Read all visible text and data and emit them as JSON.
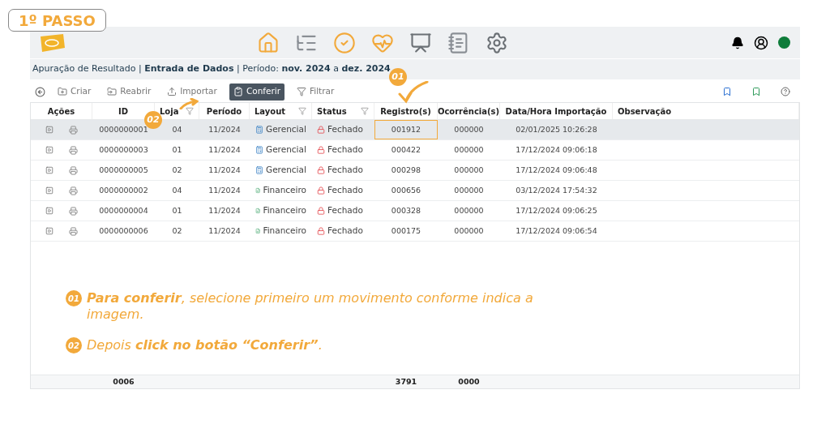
{
  "step_badge": "1º PASSO",
  "breadcrumb": "Apuração de Resultado | **Entrada de Dados** | Período: **nov. 2024** a **dez. 2024**",
  "pointer_badges": [
    {
      "number": "01"
    },
    {
      "number": "02"
    }
  ],
  "toolbar": [
    {
      "label": "Criar",
      "kind": "create",
      "selected": false
    },
    {
      "label": "Reabrir",
      "kind": "reopen",
      "selected": false
    },
    {
      "label": "Importar",
      "kind": "import",
      "selected": false
    },
    {
      "label": "Conferir",
      "kind": "check",
      "selected": true
    },
    {
      "label": "Filtrar",
      "kind": "filter",
      "selected": false
    }
  ],
  "table": {
    "columns": [
      {
        "label": "Ações",
        "filter": false
      },
      {
        "label": "ID",
        "filter": false
      },
      {
        "label": "Loja",
        "filter": true
      },
      {
        "label": "Período",
        "filter": false
      },
      {
        "label": "Layout",
        "filter": true
      },
      {
        "label": "Status",
        "filter": true
      },
      {
        "label": "Registro(s)",
        "filter": false
      },
      {
        "label": "Ocorrência(s)",
        "filter": false
      },
      {
        "label": "Data/Hora Importação",
        "filter": false
      },
      {
        "label": "Observação",
        "filter": false
      }
    ],
    "rows": [
      {
        "selected": true,
        "id": "0000000001",
        "store": "04",
        "period": "11/2024",
        "layout": "Gerencial",
        "kind": "gerencial",
        "status": "Fechado",
        "records": "001912",
        "records_highlighted": true,
        "occurrences": "000000",
        "imported_at": "02/01/2025 10:26:28"
      },
      {
        "selected": false,
        "id": "0000000003",
        "store": "01",
        "period": "11/2024",
        "layout": "Gerencial",
        "kind": "gerencial",
        "status": "Fechado",
        "records": "000422",
        "records_highlighted": false,
        "occurrences": "000000",
        "imported_at": "17/12/2024 09:06:18"
      },
      {
        "selected": false,
        "id": "0000000005",
        "store": "02",
        "period": "11/2024",
        "layout": "Gerencial",
        "kind": "gerencial",
        "status": "Fechado",
        "records": "000298",
        "records_highlighted": false,
        "occurrences": "000000",
        "imported_at": "17/12/2024 09:06:48"
      },
      {
        "selected": false,
        "id": "0000000002",
        "store": "04",
        "period": "11/2024",
        "layout": "Financeiro",
        "kind": "financeiro",
        "status": "Fechado",
        "records": "000656",
        "records_highlighted": false,
        "occurrences": "000000",
        "imported_at": "03/12/2024 17:54:32"
      },
      {
        "selected": false,
        "id": "0000000004",
        "store": "01",
        "period": "11/2024",
        "layout": "Financeiro",
        "kind": "financeiro",
        "status": "Fechado",
        "records": "000328",
        "records_highlighted": false,
        "occurrences": "000000",
        "imported_at": "17/12/2024 09:06:25"
      },
      {
        "selected": false,
        "id": "0000000006",
        "store": "02",
        "period": "11/2024",
        "layout": "Financeiro",
        "kind": "financeiro",
        "status": "Fechado",
        "records": "000175",
        "records_highlighted": false,
        "occurrences": "000000",
        "imported_at": "17/12/2024 09:06:54"
      }
    ],
    "totals": {
      "id": "0006",
      "records": "3791",
      "occurrences": "0000"
    }
  },
  "callouts": [
    {
      "number": "01",
      "text": "**Para conferir**, selecione primeiro um movimento conforme indica a imagem."
    },
    {
      "number": "02",
      "text": "Depois **click no botão “Conferir”**."
    }
  ]
}
